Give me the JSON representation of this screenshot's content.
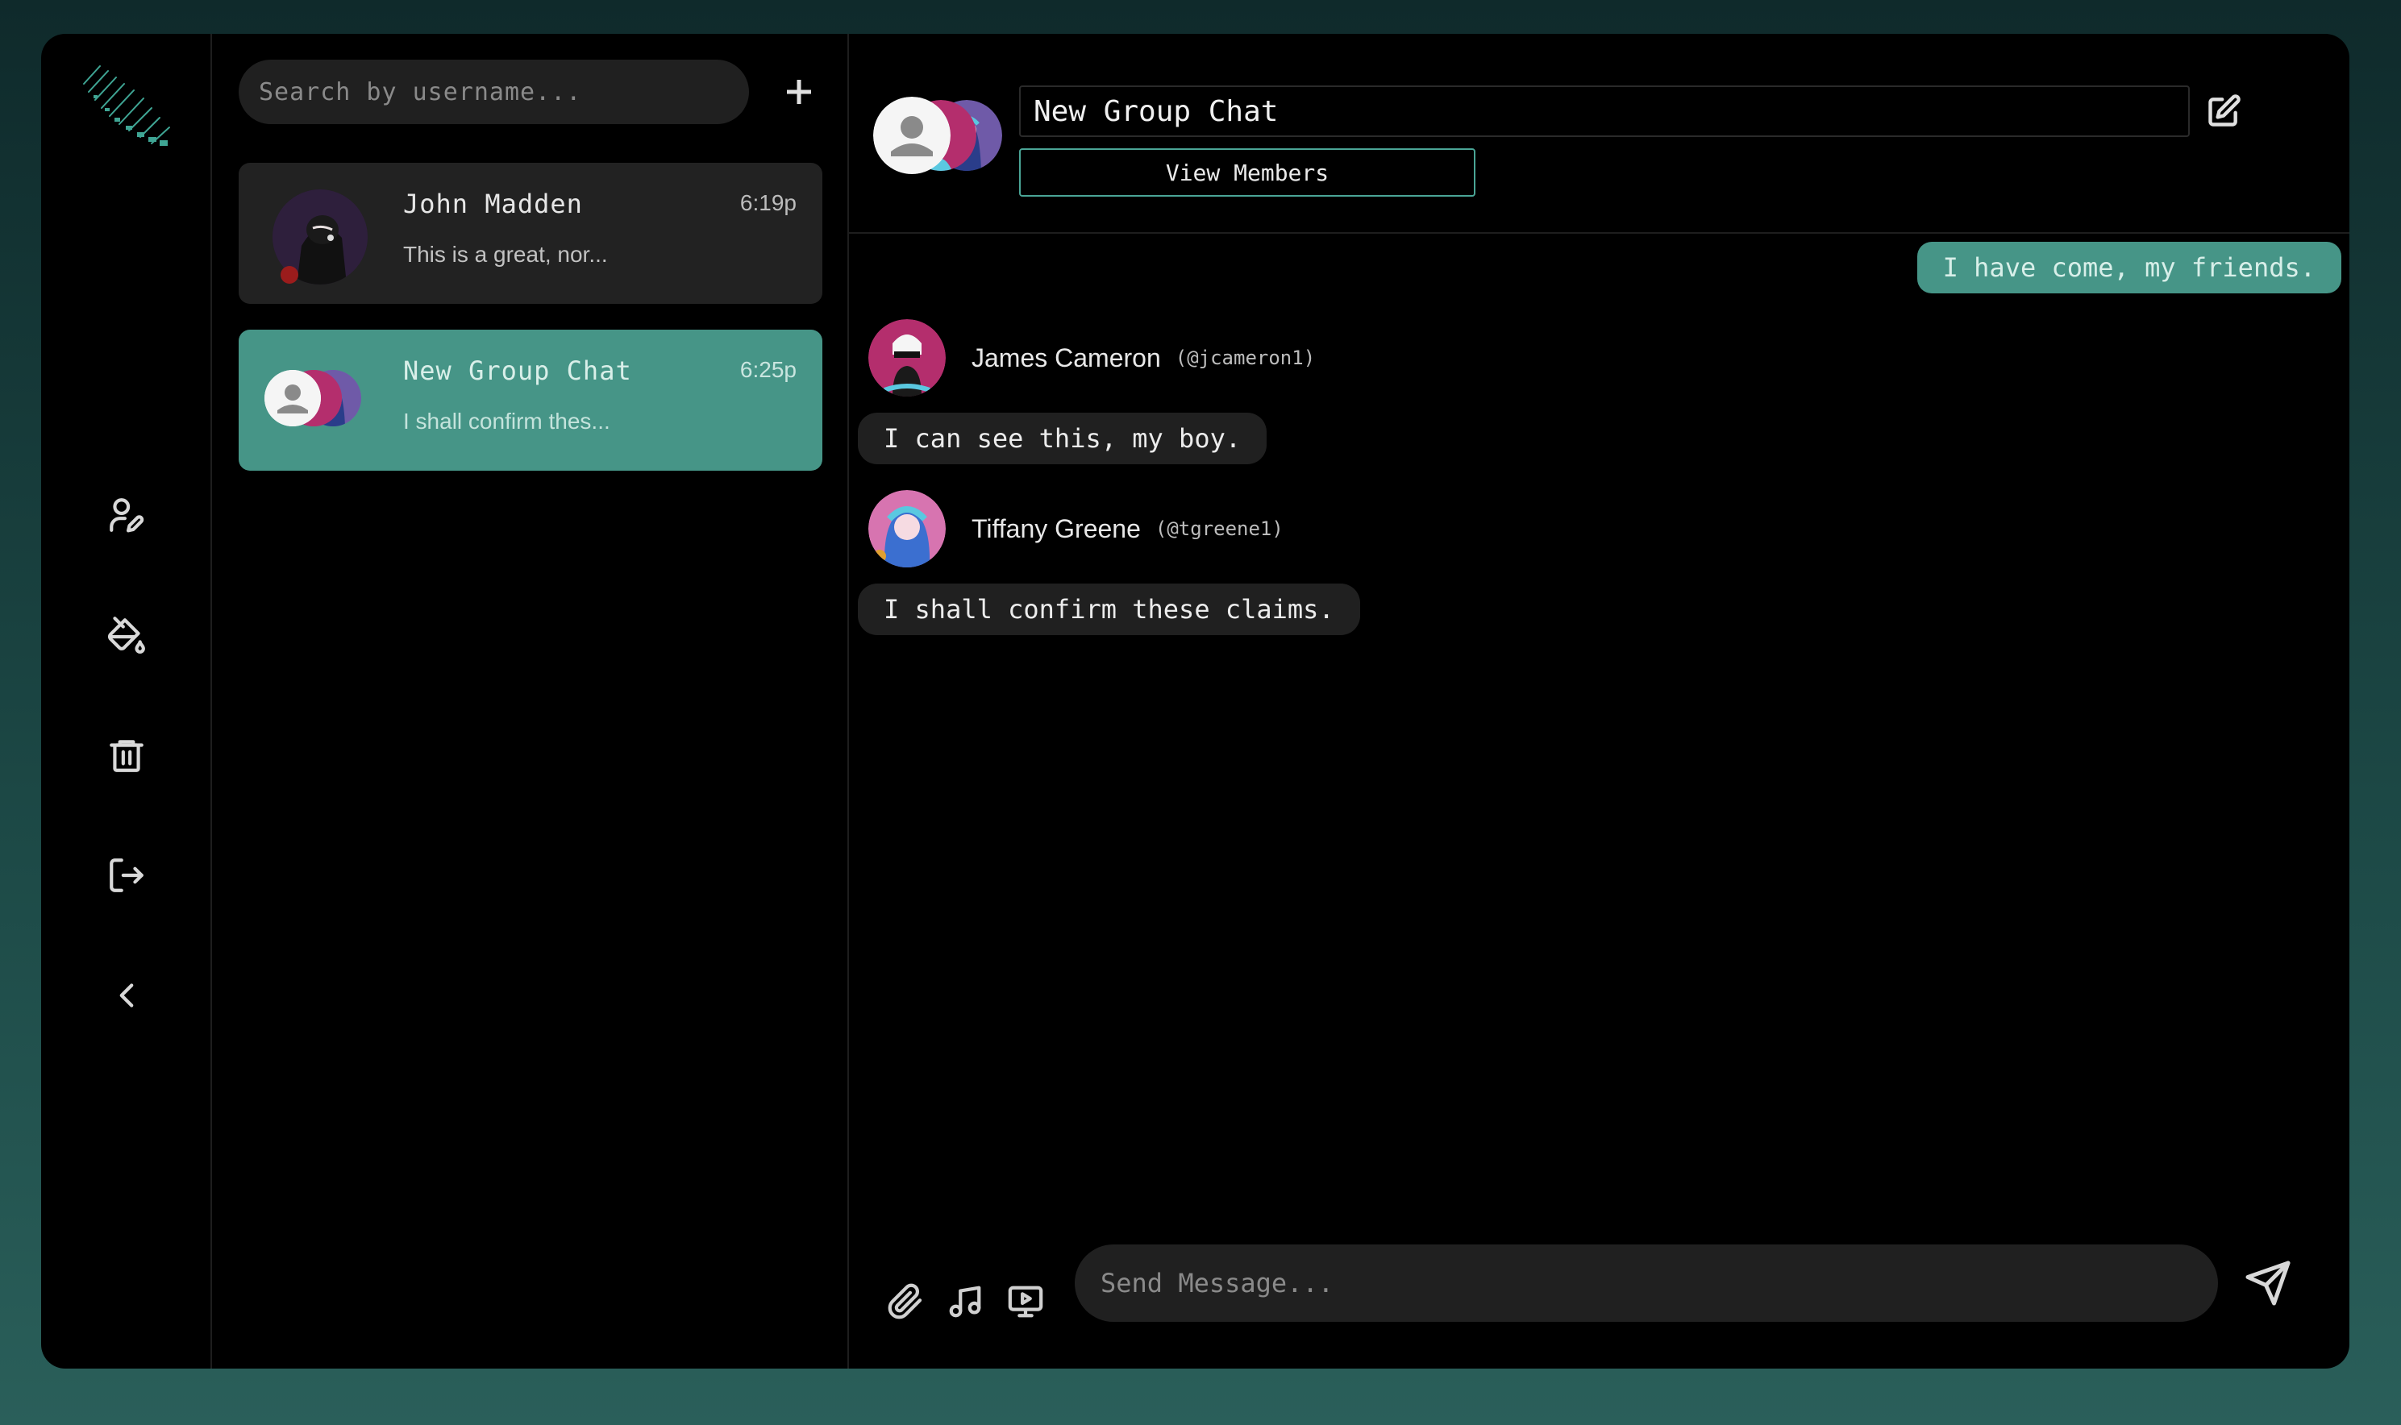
{
  "colors": {
    "accent": "#469587",
    "accent_border": "#4aa596",
    "panel": "#000000",
    "surface": "#202020",
    "status_offline": "#9b1c1c"
  },
  "rail": {
    "items": [
      {
        "icon": "user-edit-icon",
        "label": "Edit profile"
      },
      {
        "icon": "paint-bucket-icon",
        "label": "Theme"
      },
      {
        "icon": "trash-icon",
        "label": "Delete"
      },
      {
        "icon": "logout-icon",
        "label": "Log out"
      },
      {
        "icon": "chevron-left-icon",
        "label": "Collapse"
      }
    ]
  },
  "chat_list": {
    "search_placeholder": "Search by username...",
    "items": [
      {
        "name": "John Madden",
        "time": "6:19p",
        "preview": "This is a great, nor...",
        "status": "offline"
      },
      {
        "name": "New Group Chat",
        "time": "6:25p",
        "preview": "I shall confirm thes...",
        "selected": true
      }
    ]
  },
  "header": {
    "chat_title": "New Group Chat",
    "view_members_label": "View Members"
  },
  "messages": [
    {
      "own": true,
      "text": "I have come, my friends."
    },
    {
      "sender": "James Cameron",
      "handle": "(@jcameron1)",
      "text": "I can see this, my boy."
    },
    {
      "sender": "Tiffany Greene",
      "handle": "(@tgreene1)",
      "text": "I shall confirm these claims."
    }
  ],
  "composer": {
    "placeholder": "Send Message..."
  }
}
